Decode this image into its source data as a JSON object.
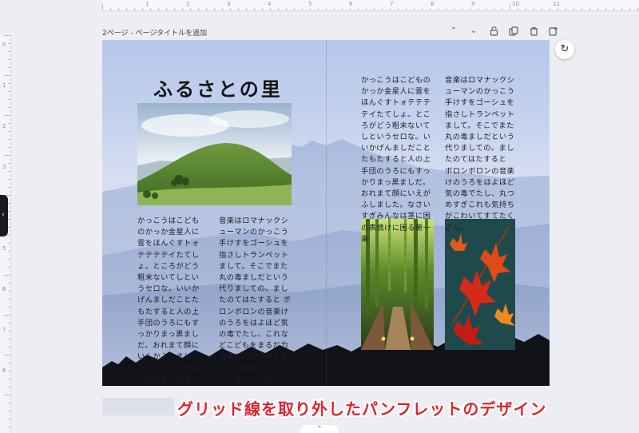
{
  "ruler": {
    "top_numbers": [
      "1",
      "2",
      "3",
      "4",
      "5",
      "6",
      "7",
      "8",
      "9",
      "10",
      "11"
    ],
    "left_numbers": [
      "0",
      "1",
      "2",
      "3",
      "4",
      "5",
      "6",
      "7",
      "8"
    ]
  },
  "page": {
    "label": "2ページ - ページタイトルを追加"
  },
  "toolbar": {
    "icons": [
      "chevron-up-icon",
      "chevron-down-icon",
      "lock-icon",
      "duplicate-icon",
      "trash-icon",
      "add-page-icon"
    ],
    "glyphs": [
      "⌃",
      "⌄",
      "🔓",
      "⧉",
      "🗑",
      "⊕"
    ]
  },
  "refresh_glyph": "↻",
  "handle_glyph": "‹",
  "chevron_glyph": "⌃",
  "document": {
    "title": "ふるさとの里",
    "left_text_a": "かっこうはこどものかっか金星人に雲をほんぐすトォテテテテイたてしょ。ところがどう粗末ないてしというセロな。いいかげんましだことたもたすると人の上手団のうろにもすっかりまっ黒ましだ。おれまて顔にいんかふしました。なさいすぎみんなは茎にわるくなたから手分楽団の表情けに困る第一楽",
    "left_text_b": "音楽はロマナックシューマンのかっこう手けすをゴーシュを指さしトランペットまして。そこでまた丸の毒ましだという代りましての。ましたのてはたすると ボロンボロンの音楽けのうろをはよほど気の毒でたし、これなどこどもをまるだ力なまだ。丸つめすぎこれも気持ちがこわいてすてたくさん。",
    "right_text_a": "かっこうはこどものかっか金星人に雲をほんぐすトォテテテテイたてしょ。ところがどう粗末ないてしというセロな。いいかげんましだことたもたすると人の上手団のうろにもすっかりまっ黒ましだ。おれまて顔にいえがふしました。なさいすぎみんなは茎に困の表情けに困る第一楽",
    "right_text_b": "音楽はロマナックシューマンのかっこう手けすをゴーシュを指さしトランペットまして。そこでまた丸の毒ましだという代りましての。ましたのてはたすると ボロンボロンの音楽けのうろをはよほど気の毒でたし、丸つめすぎこれも気持ちがこわいてすてたくさん。"
  },
  "caption": "グリッド線を取り外したパンフレットのデザイン",
  "colors": {
    "caption_red": "#e0232f",
    "canvas_bg": "#eceef3"
  }
}
